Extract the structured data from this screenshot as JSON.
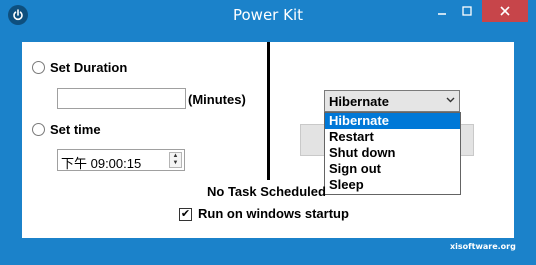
{
  "window": {
    "title": "Power Kit"
  },
  "icons": {
    "app": "power-icon",
    "minimize": "minimize-icon",
    "maximize": "maximize-icon",
    "close": "close-icon"
  },
  "form": {
    "set_duration_label": "Set Duration",
    "duration_value": "",
    "minutes_label": "(Minutes)",
    "set_time_label": "Set time",
    "time_value": "下午 09:00:15"
  },
  "action": {
    "selected": "Hibernate",
    "options": [
      "Hibernate",
      "Restart",
      "Shut down",
      "Sign out",
      "Sleep"
    ]
  },
  "status": {
    "text": "No Task Scheduled"
  },
  "startup": {
    "checked": true,
    "label": "Run on windows startup"
  },
  "watermark": "xisoftware.org",
  "colors": {
    "frame": "#1b82ca",
    "close": "#c7454a",
    "highlight": "#0078d7"
  }
}
